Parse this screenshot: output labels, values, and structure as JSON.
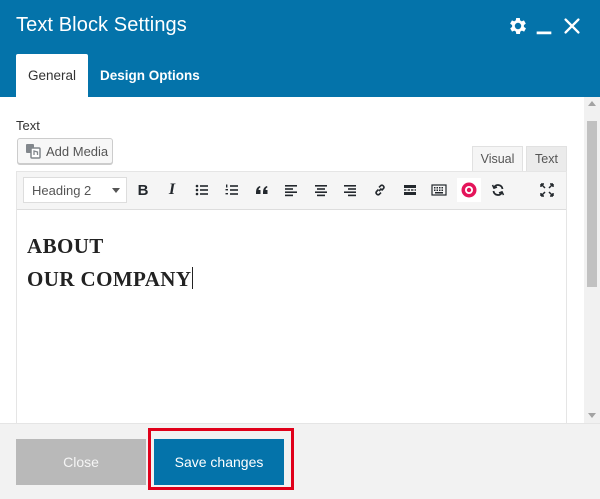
{
  "header": {
    "title": "Text Block Settings",
    "icons": [
      "gear-icon",
      "minimize-icon",
      "close-icon"
    ]
  },
  "tabs": [
    {
      "label": "General",
      "active": true
    },
    {
      "label": "Design Options",
      "active": false
    }
  ],
  "field": {
    "label": "Text",
    "add_media_label": "Add Media"
  },
  "editor_modes": {
    "visual": "Visual",
    "text": "Text"
  },
  "toolbar": {
    "format_value": "Heading 2",
    "buttons": [
      "bold",
      "italic",
      "bullet-list",
      "numbered-list",
      "blockquote",
      "align-left",
      "align-center",
      "align-right",
      "link",
      "read-more",
      "toolbar-toggle",
      "color-picker",
      "refresh",
      "fullscreen"
    ],
    "bold_glyph": "B",
    "italic_glyph": "I"
  },
  "content": {
    "lines": [
      "ABOUT",
      "OUR COMPANY"
    ]
  },
  "footer": {
    "close_label": "Close",
    "save_label": "Save changes"
  },
  "colors": {
    "header": "#0473aa",
    "save_button": "#0473aa",
    "close_button": "#b9b9b9",
    "highlight": "#e0001a"
  }
}
